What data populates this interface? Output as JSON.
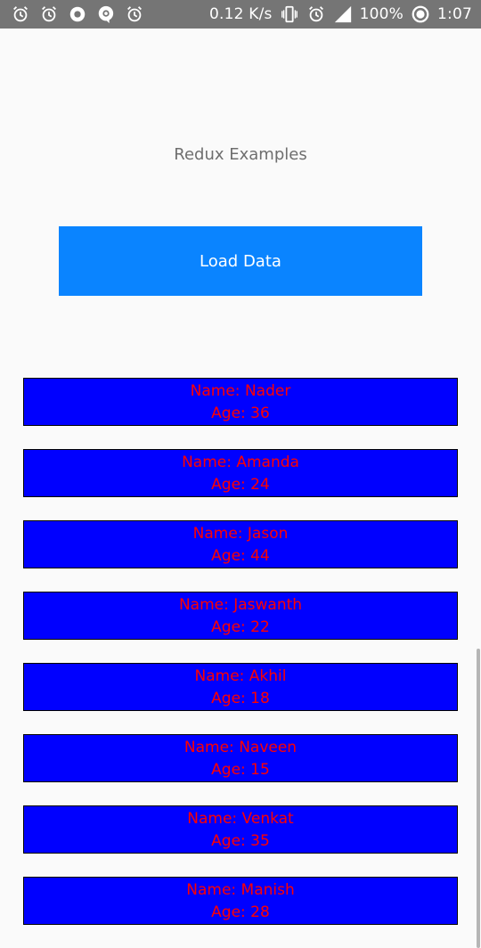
{
  "status_bar": {
    "network_speed": "0.12 K/s",
    "network_type": "4G",
    "battery": "100%",
    "time": "1:07",
    "left_icons": [
      "alarm-icon",
      "alarm-icon",
      "record-icon",
      "at-notification-icon",
      "alarm-icon"
    ],
    "right_icons": [
      "vibrate-icon",
      "alarm-icon",
      "signal-icon",
      "battery-icon"
    ]
  },
  "header": {
    "title": "Redux Examples"
  },
  "actions": {
    "load_label": "Load Data"
  },
  "people": [
    {
      "name": "Name: Nader",
      "age": "Age: 36"
    },
    {
      "name": "Name: Amanda",
      "age": "Age: 24"
    },
    {
      "name": "Name: Jason",
      "age": "Age: 44"
    },
    {
      "name": "Name: Jaswanth",
      "age": "Age: 22"
    },
    {
      "name": "Name: Akhil",
      "age": "Age: 18"
    },
    {
      "name": "Name: Naveen",
      "age": "Age: 15"
    },
    {
      "name": "Name: Venkat",
      "age": "Age: 35"
    },
    {
      "name": "Name: Manish",
      "age": "Age: 28"
    }
  ],
  "colors": {
    "status_bar_bg": "#757575",
    "button_bg": "#0a84ff",
    "card_bg": "#0000ff",
    "card_text": "#ff0000",
    "title_text": "#6e6e6e"
  }
}
